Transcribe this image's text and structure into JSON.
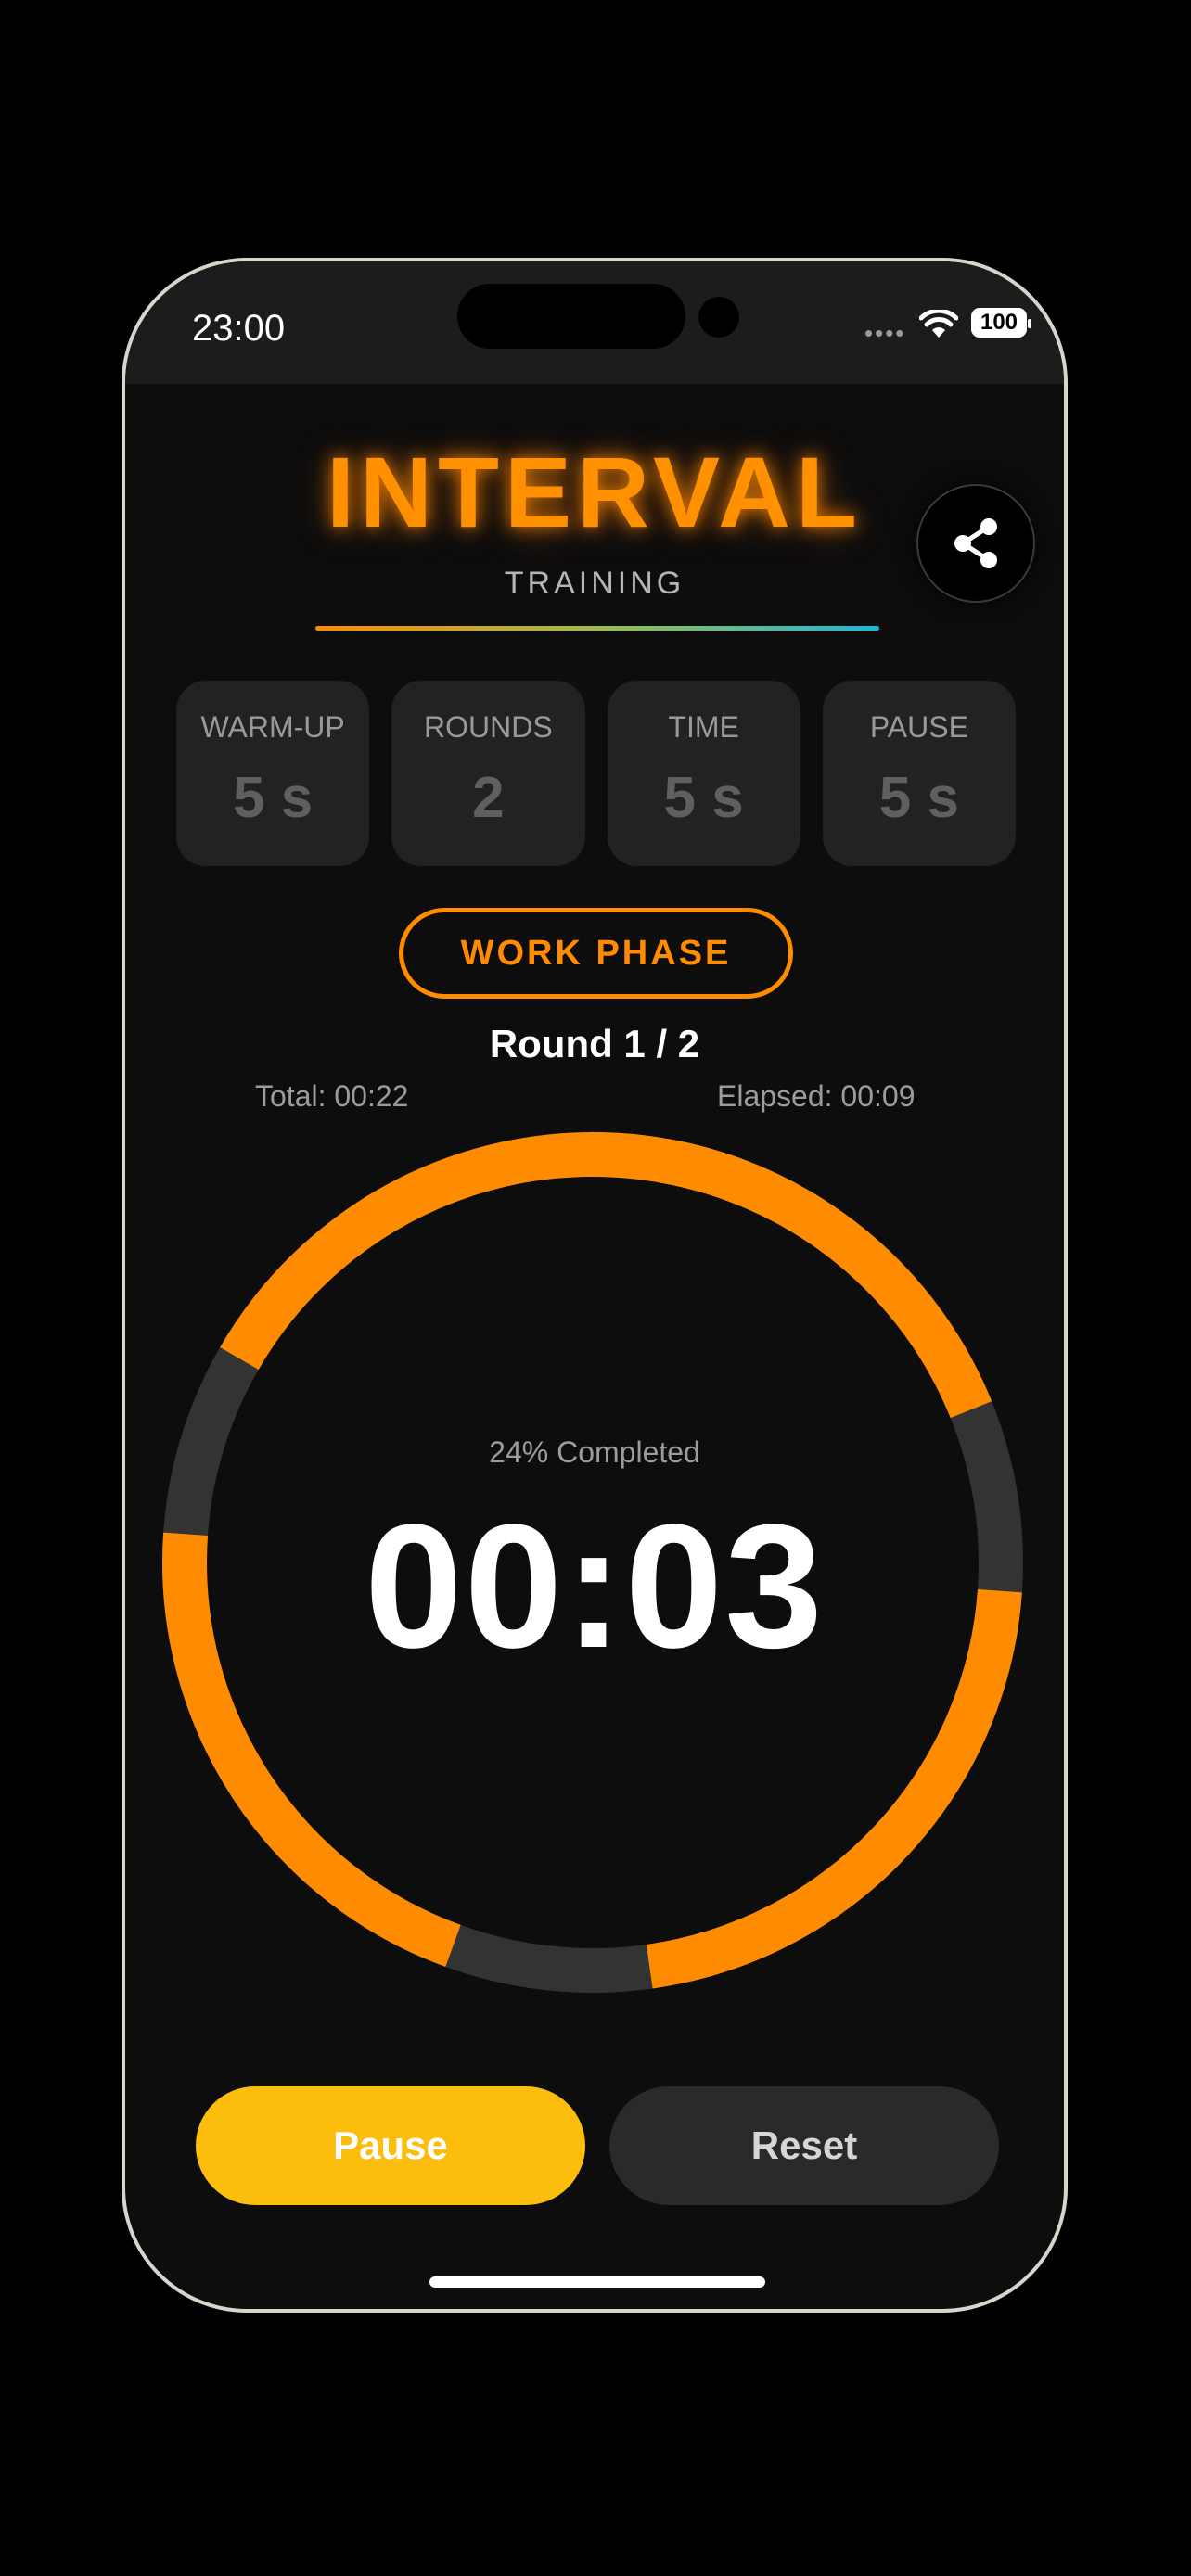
{
  "status_bar": {
    "time": "23:00",
    "battery": "100"
  },
  "header": {
    "title": "INTERVAL",
    "subtitle": "TRAINING"
  },
  "settings": [
    {
      "label": "WARM-UP",
      "value": "5  s"
    },
    {
      "label": "ROUNDS",
      "value": "2"
    },
    {
      "label": "TIME",
      "value": "5  s"
    },
    {
      "label": "PAUSE",
      "value": "5  s"
    }
  ],
  "phase": {
    "label": "WORK PHASE"
  },
  "round": "Round 1 / 2",
  "totals": {
    "total": "Total: 00:22",
    "elapsed": "Elapsed: 00:09"
  },
  "progress": {
    "completed_text": "24% Completed",
    "timer": "00:03"
  },
  "buttons": {
    "pause": "Pause",
    "reset": "Reset"
  },
  "colors": {
    "accent": "#ff8c00",
    "pause_button": "#fdbd0c",
    "ring_track": "#333333",
    "background": "#0d0d0d"
  }
}
